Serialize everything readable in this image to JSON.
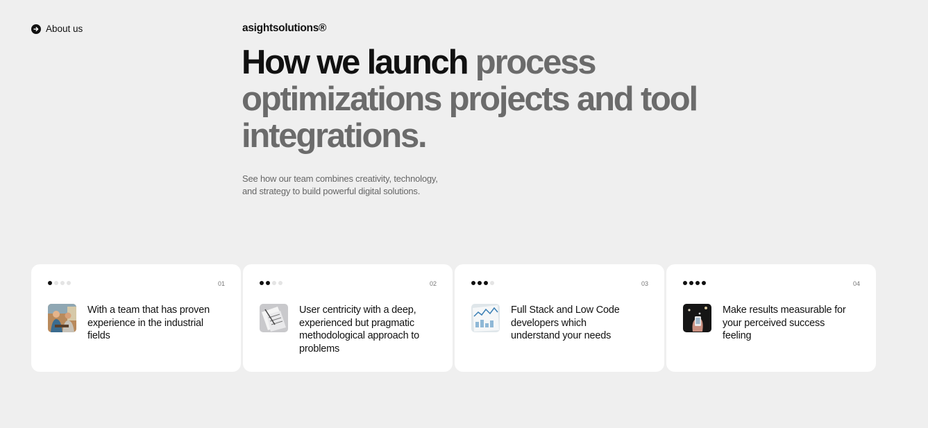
{
  "nav": {
    "about_label": "About us",
    "about_icon": "arrow-circle-icon"
  },
  "brand": {
    "name": "asightsolutions®"
  },
  "hero": {
    "title_dark": "How we launch",
    "title_grey": "process optimizations projects and tool integrations.",
    "subtitle_line1": "See how our team combines creativity, technology,",
    "subtitle_line2": "and strategy to build powerful digital solutions."
  },
  "colors": {
    "background": "#efefef",
    "card": "#ffffff",
    "text_dark": "#111111",
    "text_grey": "#6b6b6b",
    "dot_active": "#111111",
    "dot_inactive": "#e4e4e4"
  },
  "cards": [
    {
      "step": "01",
      "active_dots": 1,
      "total_dots": 4,
      "image": "team-photo",
      "text": "With a team that has proven experience in the industrial fields"
    },
    {
      "step": "02",
      "active_dots": 2,
      "total_dots": 4,
      "image": "documents-photo",
      "text": "User centricity with a deep, experienced but pragmatic methodological approach to problems"
    },
    {
      "step": "03",
      "active_dots": 3,
      "total_dots": 4,
      "image": "analytics-photo",
      "text": "Full Stack and Low Code developers which understand your needs"
    },
    {
      "step": "04",
      "active_dots": 4,
      "total_dots": 4,
      "image": "phone-photo",
      "text": "Make results measurable for your perceived success feeling"
    }
  ]
}
